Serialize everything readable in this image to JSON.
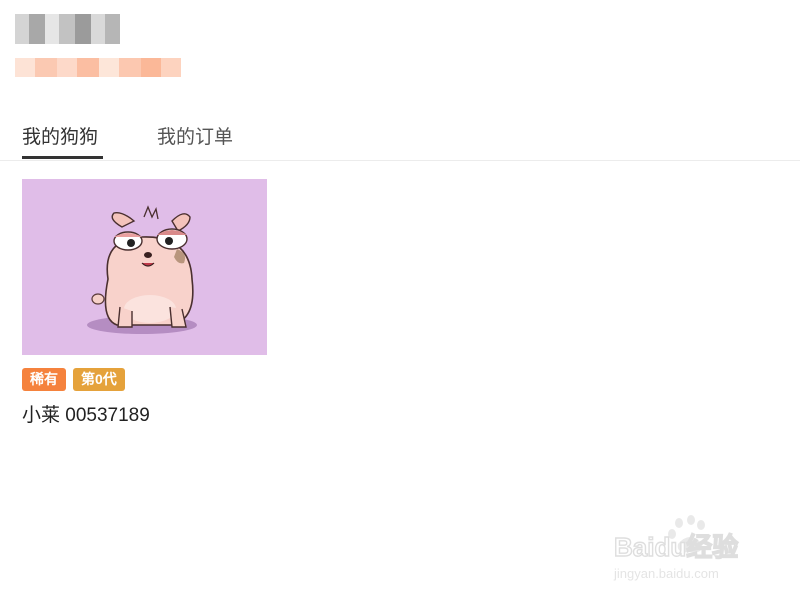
{
  "profile": {
    "name_blur_colors": [
      "#cfcfcf",
      "#a9a9a9",
      "#e4e4e4",
      "#bdbdbd",
      "#9a9a9a",
      "#d6d6d6",
      "#b3b3b3"
    ],
    "sub_blur_colors": [
      "#fde0d2",
      "#fbcab3",
      "#fdd9c9",
      "#fbbfa3",
      "#fde6d9",
      "#fcc9b1",
      "#fbb797",
      "#fdd3bf"
    ]
  },
  "tabs": [
    {
      "label": "我的狗狗",
      "active": true
    },
    {
      "label": "我的订单",
      "active": false
    }
  ],
  "dog_card": {
    "badges": {
      "rarity": "稀有",
      "generation": "第0代"
    },
    "name": "小莱 00537189",
    "image_bg": "#e0bde8"
  },
  "watermark": {
    "brand": "Baidu经验",
    "url": "jingyan.baidu.com"
  },
  "colors": {
    "accent_orange": "#f5823d",
    "accent_gold": "#e5a23b",
    "tab_underline": "#333333"
  }
}
